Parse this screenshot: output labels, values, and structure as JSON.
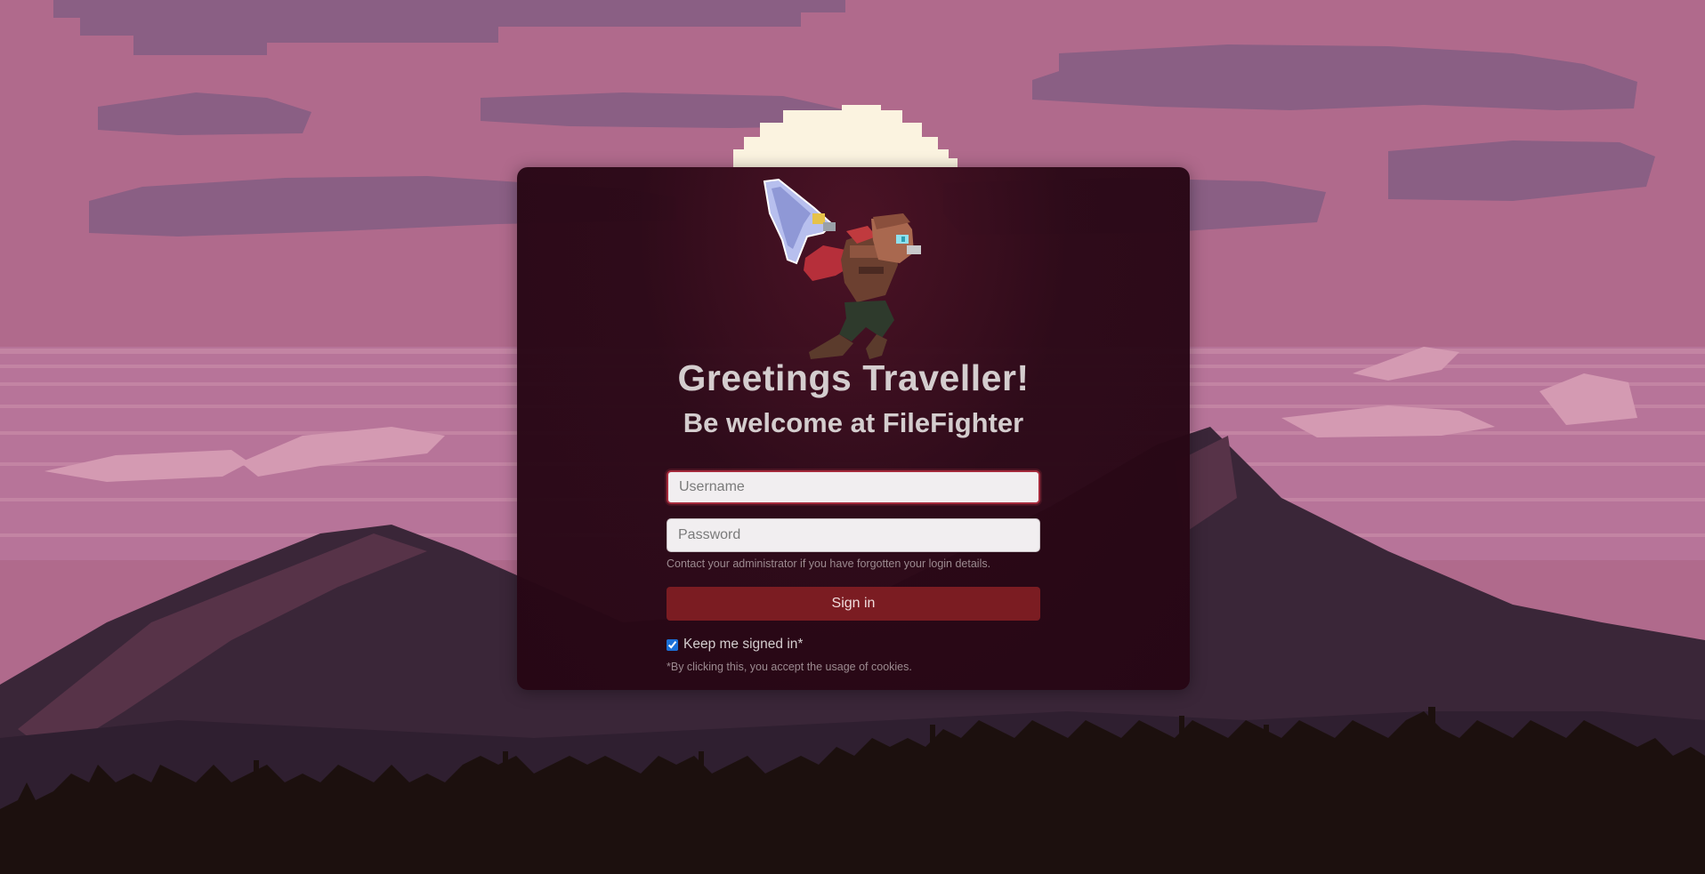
{
  "page": {
    "title": "Greetings Traveller!",
    "subtitle": "Be welcome at FileFighter"
  },
  "login": {
    "username_placeholder": "Username",
    "password_placeholder": "Password",
    "forgot_hint": "Contact your administrator if you have forgotten your login details.",
    "signin_label": "Sign in",
    "keep_signed_in_label": "Keep me signed in*",
    "keep_signed_in_checked": true,
    "cookie_note": "*By clicking this, you accept the usage of cookies."
  },
  "icons": {
    "hero": "pixel-warrior-with-sword-icon"
  },
  "colors": {
    "card_background": "#2a0816",
    "signin_button": "#7b1c22",
    "title_text": "#d4cdce",
    "sky": "#b06a8c"
  }
}
